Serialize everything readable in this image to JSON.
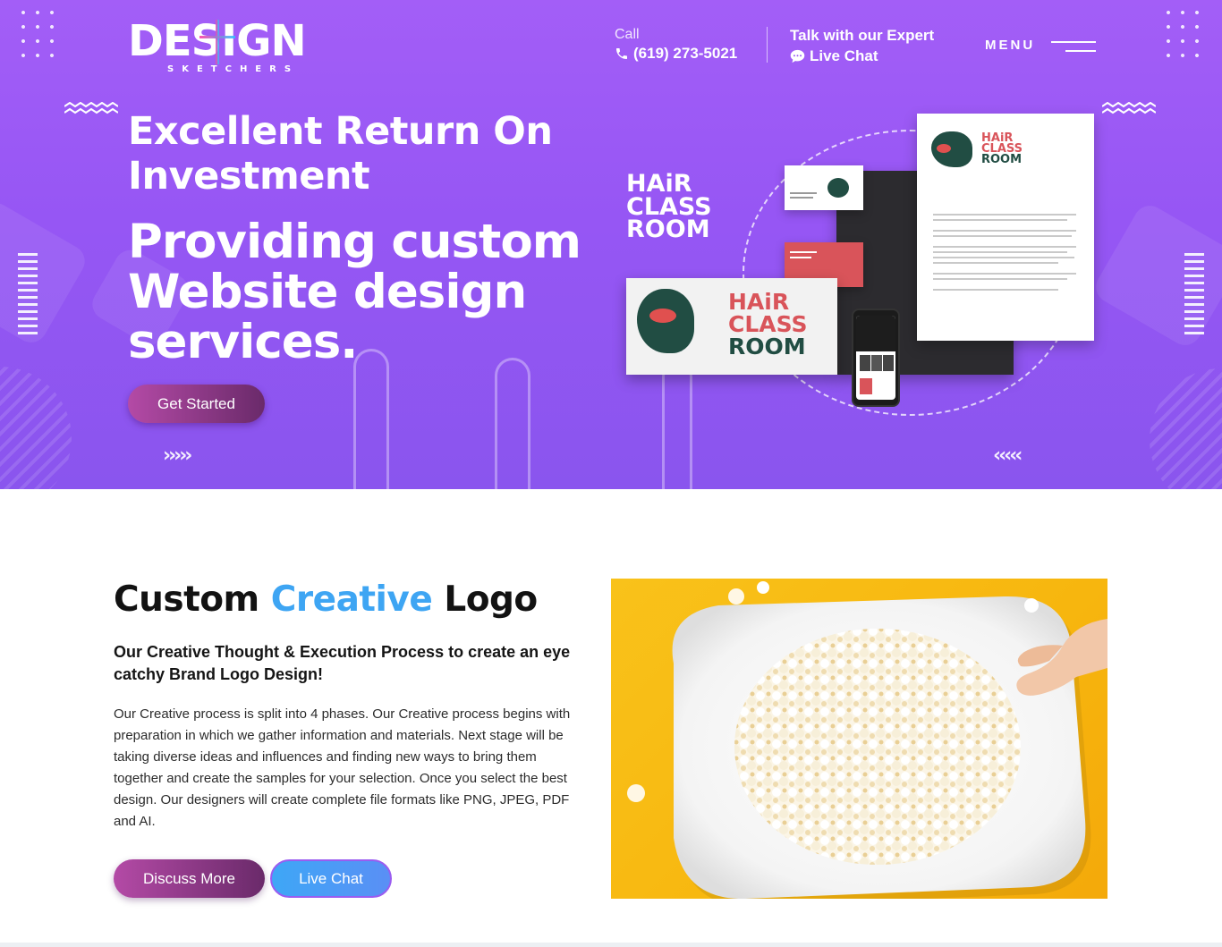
{
  "header": {
    "logo_text": "DESIGN",
    "logo_subtext": "SKETCHERS",
    "call_label": "Call",
    "phone_number": "(619) 273-5021",
    "expert_title": "Talk with our Expert",
    "live_chat_label": "Live Chat",
    "menu_label": "MENU"
  },
  "hero": {
    "title_line": "Excellent Return On Investment",
    "headline": "Providing custom Website design services.",
    "cta_label": "Get Started",
    "mockup_brand_top": "HAiR",
    "mockup_brand_mid": "CLASS",
    "mockup_brand_bottom": "ROOM"
  },
  "logo_section": {
    "title_part1": "Custom",
    "title_accent": "Creative",
    "title_part2": "Logo",
    "subtitle": "Our Creative Thought & Execution Process to create an eye catchy Brand Logo Design!",
    "body": "Our Creative process is split into 4 phases. Our Creative process begins with preparation in which we gather information and materials. Next stage will be taking diverse ideas and influences and finding new ways to bring them together and create the samples for your selection. Once you select the best design. Our designers will create complete file formats like PNG, JPEG, PDF and AI.",
    "discuss_button": "Discuss More",
    "live_chat_button": "Live Chat"
  },
  "icons": {
    "phone": "phone-icon",
    "chat": "chat-bubble-icon",
    "menu": "hamburger-icon"
  },
  "colors": {
    "hero_purple": "#9a5af5",
    "accent_blue": "#3ea5f3",
    "button_magenta": "#b44aa6",
    "button_plum": "#6a2a6a",
    "popcorn_yellow": "#f7b60e"
  }
}
